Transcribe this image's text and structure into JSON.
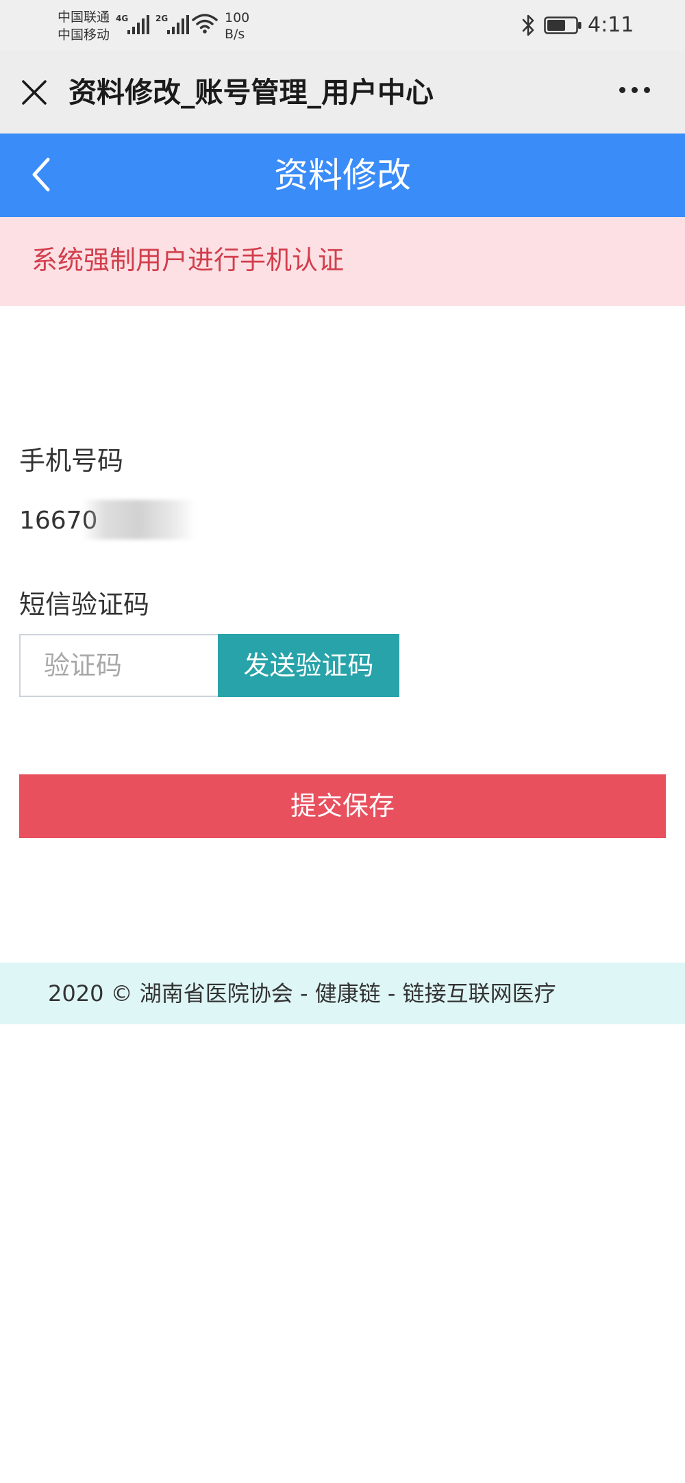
{
  "status_bar": {
    "carrier_1": "中国联通",
    "carrier_2": "中国移动",
    "net_1": "4G",
    "net_2": "2G",
    "speed_value": "100",
    "speed_unit": "B/s",
    "time": "4:11"
  },
  "browser": {
    "title": "资料修改_账号管理_用户中心"
  },
  "header": {
    "title": "资料修改"
  },
  "alert": {
    "message": "系统强制用户进行手机认证"
  },
  "form": {
    "phone_label": "手机号码",
    "phone_value": "16670",
    "sms_label": "短信验证码",
    "code_placeholder": "验证码",
    "code_value": "",
    "send_code_label": "发送验证码",
    "submit_label": "提交保存"
  },
  "footer": {
    "text": "2020 © 湖南省医院协会 - 健康链 - 链接互联网医疗"
  },
  "colors": {
    "header_bg": "#3a8cf8",
    "alert_bg": "#fce0e4",
    "alert_text": "#d23e4c",
    "send_button": "#27a3a9",
    "submit_button": "#e8505e",
    "footer_bg": "#dff6f6"
  },
  "icons": {
    "close": "close-icon",
    "more": "more-icon",
    "back": "back-icon",
    "wifi": "wifi-icon",
    "bluetooth": "bluetooth-icon",
    "battery": "battery-icon"
  }
}
